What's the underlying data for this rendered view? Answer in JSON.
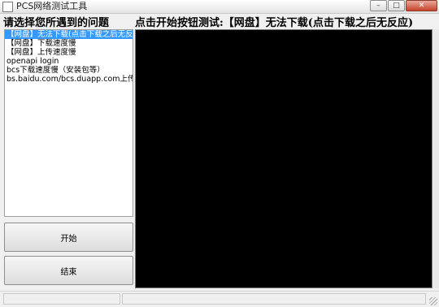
{
  "window": {
    "title": "PCS网络测试工具",
    "controls": {
      "minimize": "–",
      "maximize": "□",
      "close": "✕"
    }
  },
  "left_heading": "请选择您所遇到的问题",
  "right_heading": "点击开始按钮测试:【网盘】无法下载(点击下载之后无反应)",
  "problems": [
    {
      "label": "【网盘】无法下载(点击下载之后无反应)",
      "selected": true
    },
    {
      "label": "【网盘】下载速度慢",
      "selected": false
    },
    {
      "label": "【网盘】上传速度慢",
      "selected": false
    },
    {
      "label": "openapi login",
      "selected": false
    },
    {
      "label": "bcs下载速度慢（安装包等）",
      "selected": false
    },
    {
      "label": "bs.baidu.com/bcs.duapp.com上传慢",
      "selected": false
    }
  ],
  "buttons": {
    "start": "开始",
    "stop": "结束"
  },
  "output": {
    "text": ""
  }
}
